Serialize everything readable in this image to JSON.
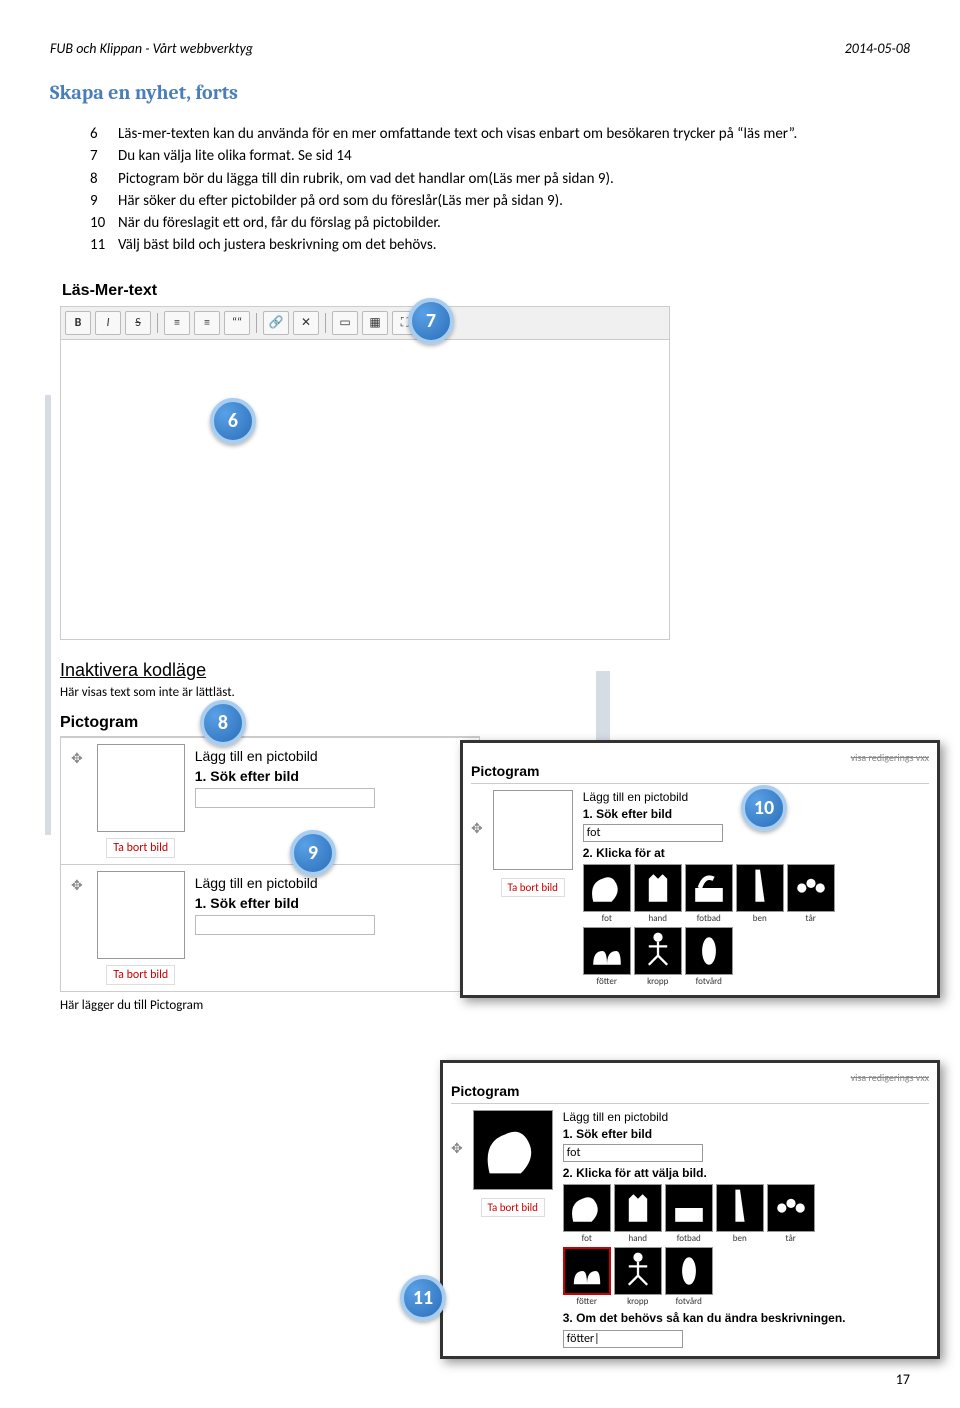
{
  "header": {
    "left": "FUB och Klippan - Vårt webbverktyg",
    "right": "2014-05-08"
  },
  "section_title": "Skapa en nyhet, forts",
  "list": [
    {
      "n": "6",
      "t": "Läs-mer-texten kan du använda för en mer omfattande text och visas enbart om besökaren trycker på “läs mer”."
    },
    {
      "n": "7",
      "t": "Du kan välja lite olika format. Se sid 14"
    },
    {
      "n": "8",
      "t": "Pictogram bör du lägga till din rubrik, om vad det handlar om(Läs mer på sidan 9)."
    },
    {
      "n": "9",
      "t": "Här söker du efter pictobilder på ord som du föreslår(Läs mer på sidan 9)."
    },
    {
      "n": "10",
      "t": "När du föreslagit ett ord, får du förslag på pictobilder."
    },
    {
      "n": "11",
      "t": "Välj bäst bild och justera beskrivning om det behövs."
    }
  ],
  "editor": {
    "title": "Läs-Mer-text",
    "btns": {
      "b": "B",
      "i": "I",
      "s": "S",
      "ul": "≡",
      "ol": "≡",
      "quote": "““",
      "link": "🔗",
      "unlink": "✕",
      "hr": "▭",
      "img": "▦",
      "full": "⛶"
    }
  },
  "inaktivera": {
    "title": "Inaktivera kodläge",
    "sub": "Här visas text som inte är lättläst."
  },
  "picto": {
    "title": "Pictogram",
    "add": "Lägg till en pictobild",
    "step1": "1. Sök efter bild",
    "remove": "Ta bort bild",
    "footer": "Här lägger du till Pictogram"
  },
  "badges": {
    "b6": "6",
    "b7": "7",
    "b8": "8",
    "b9": "9",
    "b10": "10",
    "b11": "11"
  },
  "ov10": {
    "title": "Pictogram",
    "add": "Lägg till en pictobild",
    "s1": "1. Sök efter bild",
    "input": "fot",
    "s2": "2. Klicka för at",
    "remove": "Ta bort bild",
    "thumbs1": [
      {
        "l": "fot",
        "f": "F"
      },
      {
        "l": "hand",
        "f": "H"
      },
      {
        "l": "fotbad",
        "f": "FB"
      },
      {
        "l": "ben",
        "f": "B"
      },
      {
        "l": "tår",
        "f": "T"
      }
    ],
    "thumbs2": [
      {
        "l": "fötter",
        "f": "Ft"
      },
      {
        "l": "kropp",
        "f": "K"
      },
      {
        "l": "fotvård",
        "f": "Fv"
      }
    ]
  },
  "ov11": {
    "title": "Pictogram",
    "add": "Lägg till en pictobild",
    "s1": "1. Sök efter bild",
    "input": "fot",
    "s2": "2. Klicka för att välja bild.",
    "remove": "Ta bort bild",
    "thumbs1": [
      {
        "l": "fot",
        "f": "F"
      },
      {
        "l": "hand",
        "f": "H"
      },
      {
        "l": "fotbad",
        "f": "FB"
      },
      {
        "l": "ben",
        "f": "B"
      },
      {
        "l": "tår",
        "f": "T"
      }
    ],
    "thumbs2": [
      {
        "l": "fötter",
        "f": "Ft"
      },
      {
        "l": "kropp",
        "f": "K"
      },
      {
        "l": "fotvård",
        "f": "Fv"
      }
    ],
    "s3": "3. Om det behövs så kan du ändra beskrivningen.",
    "desc": "fötter|"
  },
  "page_num": "17"
}
